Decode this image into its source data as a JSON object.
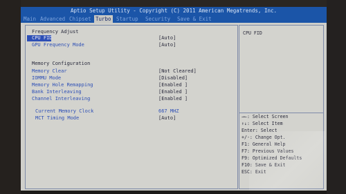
{
  "title": "Aptio Setup Utility - Copyright (C) 2011 American Megatrends, Inc.",
  "tabs": [
    "Main",
    "Advanced",
    "Chipset",
    "Turbo",
    "Startup",
    "Security",
    "Save & Exit"
  ],
  "active_tab": "Turbo",
  "main": {
    "section1_heading": "Frequency Adjust",
    "section2_heading": "Memory Configuration",
    "settings": [
      {
        "label": "CPU FID",
        "value": "[Auto]"
      },
      {
        "label": "GPU Frequency Mode",
        "value": "[Auto]"
      },
      {
        "label": "Memory Clear",
        "value": "[Not Cleared]"
      },
      {
        "label": "IOMMU Mode",
        "value": "[Disabled]"
      },
      {
        "label": "Memory Hole Remapping",
        "value": "[Enabled ]"
      },
      {
        "label": "Bank Interleaving",
        "value": "[Enabled ]"
      },
      {
        "label": "Channel Interleaving",
        "value": "[Enabled ]"
      },
      {
        "label": "Current Memory Clock",
        "value": "667 MHZ"
      },
      {
        "label": "MCT Timing Mode",
        "value": "[Auto]"
      }
    ]
  },
  "help_title": "CPU FID",
  "key_help": [
    "→←: Select Screen",
    "↑↓: Select Item",
    "Enter: Select",
    "+/-: Change Opt.",
    "F1: General Help",
    "F7: Previous Values",
    "F9: Optimized Defaults",
    "F10: Save & Exit",
    "ESC: Exit"
  ],
  "colors": {
    "title_bar": "#1b55a8",
    "screen_bg": "#cfcfca",
    "label_blue": "#2d4fb6",
    "selection_bg": "#2d4fb6"
  }
}
